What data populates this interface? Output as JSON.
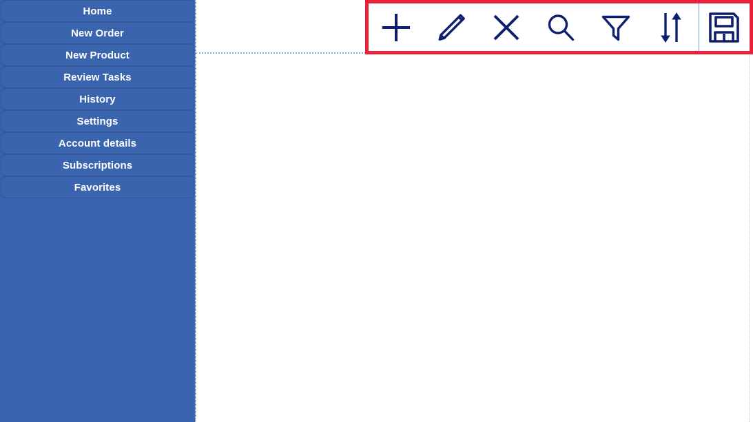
{
  "app": {
    "accent_blue": "#3a64ae",
    "icon_navy": "#0d1f6e",
    "highlight_red": "#ea2239",
    "divider_blue": "#6f9fd8"
  },
  "sidebar": {
    "items": [
      {
        "label": "Home",
        "name": "sidebar-item-home"
      },
      {
        "label": "New Order",
        "name": "sidebar-item-new-order"
      },
      {
        "label": "New Product",
        "name": "sidebar-item-new-product"
      },
      {
        "label": "Review Tasks",
        "name": "sidebar-item-review-tasks"
      },
      {
        "label": "History",
        "name": "sidebar-item-history"
      },
      {
        "label": "Settings",
        "name": "sidebar-item-settings"
      },
      {
        "label": "Account details",
        "name": "sidebar-item-account-details"
      },
      {
        "label": "Subscriptions",
        "name": "sidebar-item-subscriptions"
      },
      {
        "label": "Favorites",
        "name": "sidebar-item-favorites"
      }
    ]
  },
  "toolbar": {
    "highlighted": true,
    "buttons": [
      {
        "icon": "plus-icon",
        "label": "Add"
      },
      {
        "icon": "pencil-icon",
        "label": "Edit"
      },
      {
        "icon": "close-icon",
        "label": "Delete"
      },
      {
        "icon": "search-icon",
        "label": "Search"
      },
      {
        "icon": "filter-icon",
        "label": "Filter"
      },
      {
        "icon": "sort-icon",
        "label": "Sort"
      },
      {
        "icon": "save-icon",
        "label": "Save"
      }
    ]
  },
  "content": {
    "body_text": ""
  }
}
